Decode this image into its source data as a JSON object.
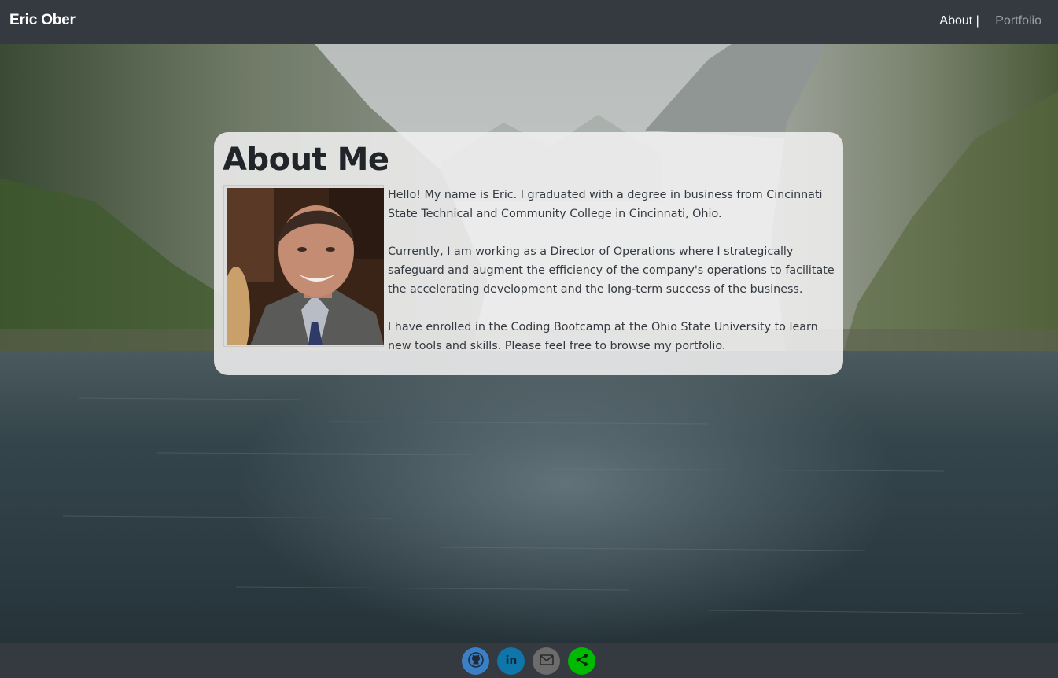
{
  "navbar": {
    "brand": "Eric Ober",
    "links": [
      {
        "label": "About |"
      },
      {
        "label": "Portfolio"
      }
    ]
  },
  "about": {
    "title": "About Me",
    "paragraphs": [
      "Hello! My name is Eric. I graduated with a degree in business from Cincinnati State Technical and Community College in Cincinnati, Ohio.",
      "Currently, I am working as a Director of Operations where I strategically safeguard and augment the efficiency of the company's operations to facilitate the accelerating development and the long-term success of the business.",
      "I have enrolled in the Coding Bootcamp at the Ohio State University to learn new tools and skills. Please feel free to browse my portfolio."
    ]
  },
  "footer": {
    "social": [
      {
        "icon": "github-icon",
        "color": "#3b7fc4"
      },
      {
        "icon": "linkedin-icon",
        "color": "#0e76a8"
      },
      {
        "icon": "mail-icon",
        "color": "#6c6c6c"
      },
      {
        "icon": "share-icon",
        "color": "#00b900"
      }
    ]
  }
}
